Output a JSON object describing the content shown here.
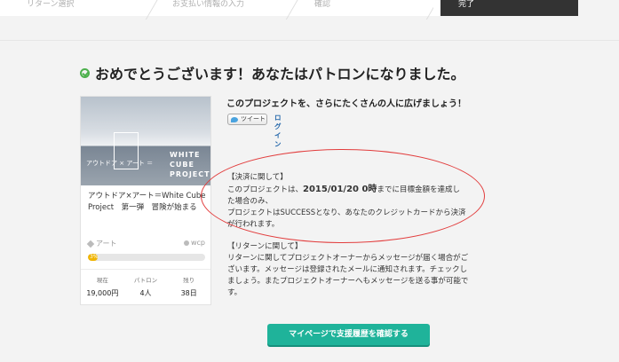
{
  "steps": [
    {
      "label": "リターン選択"
    },
    {
      "label": "お支払い情報の入力"
    },
    {
      "label": "確認"
    },
    {
      "label": "完了"
    }
  ],
  "page_title": "おめでとうございます！あなたはパトロンになりました。",
  "project": {
    "image_text_jp": "アウトドア × アート ＝",
    "image_text_en": "WHITE CUBE PROJECT",
    "title": "アウトドア×アート＝White Cube Project　第一弾　冒険が始まる",
    "category": "アート",
    "owner": "wcp",
    "progress_label": "3%",
    "progress_fraction": 0.03,
    "stats": [
      {
        "key": "現在",
        "value": "19,000円"
      },
      {
        "key": "パトロン",
        "value": "4人"
      },
      {
        "key": "残り",
        "value": "38日"
      }
    ]
  },
  "share": {
    "heading": "このプロジェクトを、さらにたくさんの人に広げましょう！",
    "tweet_label": "ツイート",
    "login_label": "ログイン"
  },
  "payment": {
    "heading": "【決済に関して】",
    "line1_prefix": "このプロジェクトは、",
    "deadline": "2015/01/20 0時",
    "line1_suffix": "までに目標金額を達成した場合のみ、",
    "line2": "プロジェクトはSUCCESSとなり、あなたのクレジットカードから決済が行われます。"
  },
  "returns": {
    "heading": "【リターンに関して】",
    "body": "リターンに関してプロジェクトオーナーからメッセージが届く場合がございます。メッセージは登録されたメールに通知されます。チェックしましょう。またプロジェクトオーナーへもメッセージを送る事が可能です。"
  },
  "cta_label": "マイページで支援履歴を確認する",
  "colors": {
    "accent": "#1fb39a",
    "highlight": "#e23d3d",
    "success": "#4cb04c"
  }
}
